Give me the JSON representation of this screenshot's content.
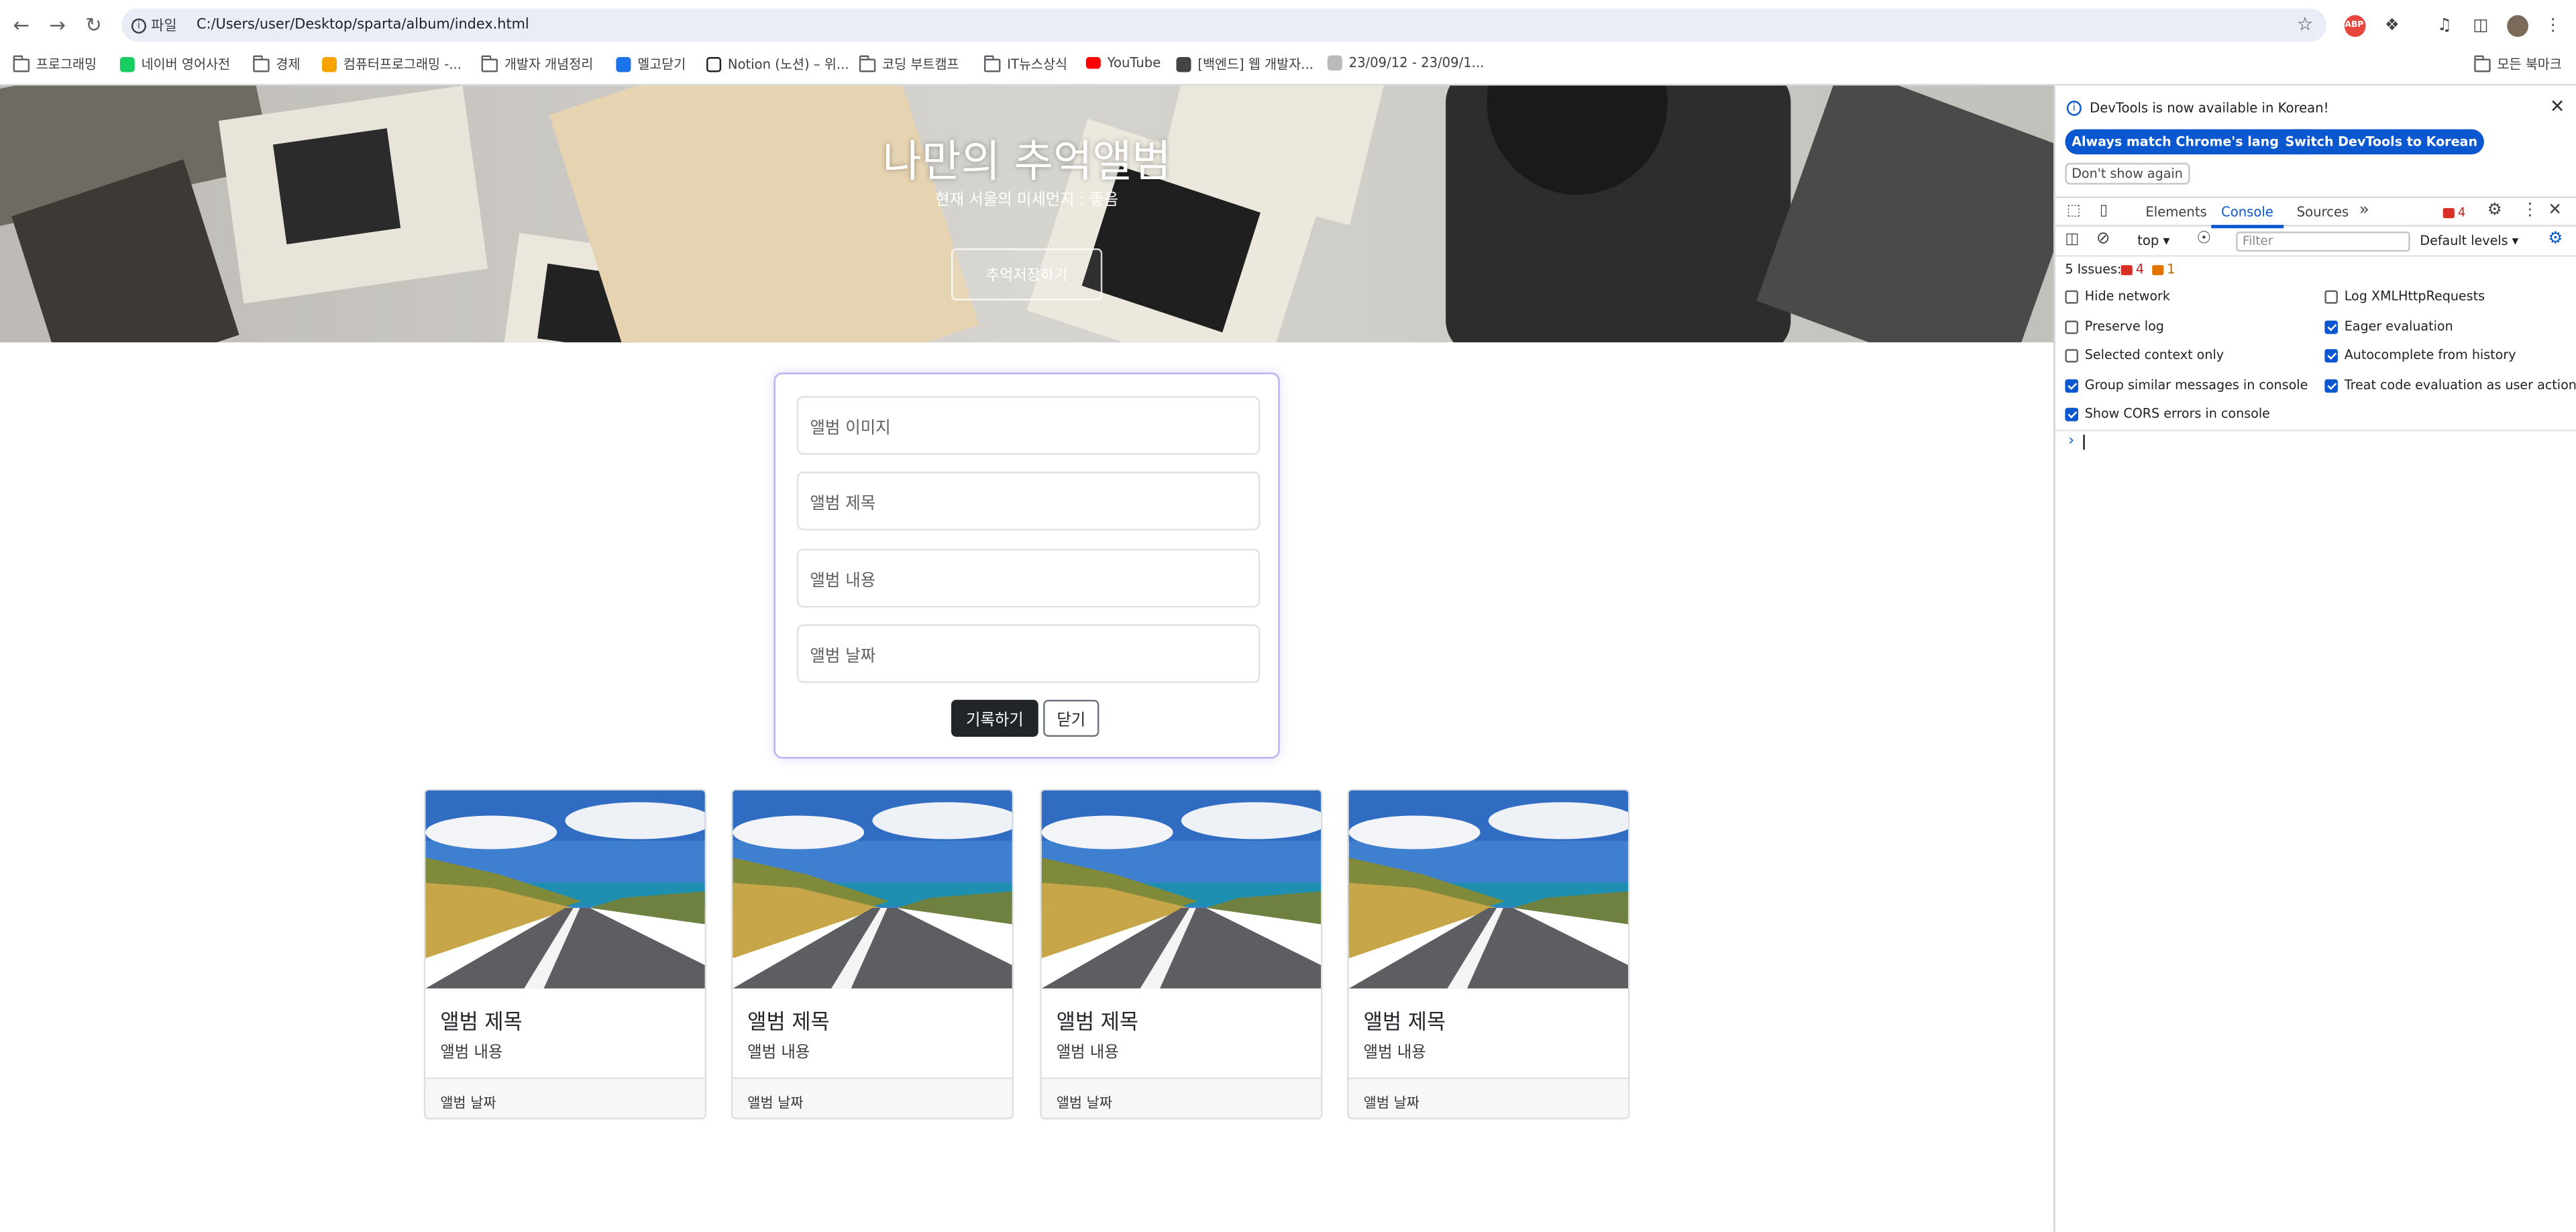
{
  "toolbar": {
    "scheme_chip": "파일",
    "url": "C:/Users/user/Desktop/sparta/album/index.html"
  },
  "bookmarks": {
    "items": [
      {
        "label": "프로그래밍",
        "icon": "folder-icon"
      },
      {
        "label": "네이버 영어사전",
        "icon": "naver-dict-icon"
      },
      {
        "label": "경제",
        "icon": "folder-icon"
      },
      {
        "label": "컴퓨터프로그래밍 -...",
        "icon": "k-icon"
      },
      {
        "label": "개발자 개념정리",
        "icon": "folder-icon"
      },
      {
        "label": "멜고닫기",
        "icon": "site-icon"
      },
      {
        "label": "Notion (노션) – 위...",
        "icon": "notion-icon"
      },
      {
        "label": "코딩 부트캠프",
        "icon": "folder-icon"
      },
      {
        "label": "IT뉴스상식",
        "icon": "folder-icon"
      },
      {
        "label": "YouTube",
        "icon": "youtube-icon"
      },
      {
        "label": "[백엔드] 웹 개발자...",
        "icon": "site-icon"
      },
      {
        "label": "23/09/12 - 23/09/1...",
        "icon": "site-icon"
      }
    ],
    "all_bookmarks": "모든 북마크"
  },
  "hero": {
    "title": "나만의 추억앨범",
    "subtitle": "현재 서울의 미세먼지 : 좋음",
    "button": "추억저장하기"
  },
  "form": {
    "image_placeholder": "앨범 이미지",
    "title_placeholder": "앨범 제목",
    "content_placeholder": "앨범 내용",
    "date_placeholder": "앨범 날짜",
    "save_button": "기록하기",
    "close_button": "닫기"
  },
  "cards": [
    {
      "title": "앨범 제목",
      "content": "앨범 내용",
      "date": "앨범 날짜"
    },
    {
      "title": "앨범 제목",
      "content": "앨범 내용",
      "date": "앨범 날짜"
    },
    {
      "title": "앨범 제목",
      "content": "앨범 내용",
      "date": "앨범 날짜"
    },
    {
      "title": "앨범 제목",
      "content": "앨범 내용",
      "date": "앨범 날짜"
    }
  ],
  "devtools": {
    "banner_text": "DevTools is now available in Korean!",
    "match_language_button": "Always match Chrome's language",
    "switch_korean_button": "Switch DevTools to Korean",
    "dont_show_button": "Don't show again",
    "tabs": [
      "Elements",
      "Console",
      "Sources"
    ],
    "error_count": "4",
    "context": "top",
    "filter_placeholder": "Filter",
    "levels": "Default levels",
    "issues_label": "5 Issues:",
    "issues_errors": "4",
    "issues_warnings": "1",
    "options": [
      {
        "label": "Hide network",
        "checked": false
      },
      {
        "label": "Log XMLHttpRequests",
        "checked": false
      },
      {
        "label": "Preserve log",
        "checked": false
      },
      {
        "label": "Eager evaluation",
        "checked": true
      },
      {
        "label": "Selected context only",
        "checked": false
      },
      {
        "label": "Autocomplete from history",
        "checked": true
      },
      {
        "label": "Group similar messages in console",
        "checked": true
      },
      {
        "label": "Treat code evaluation as user action",
        "checked": true
      },
      {
        "label": "Show CORS errors in console",
        "checked": true
      }
    ]
  }
}
